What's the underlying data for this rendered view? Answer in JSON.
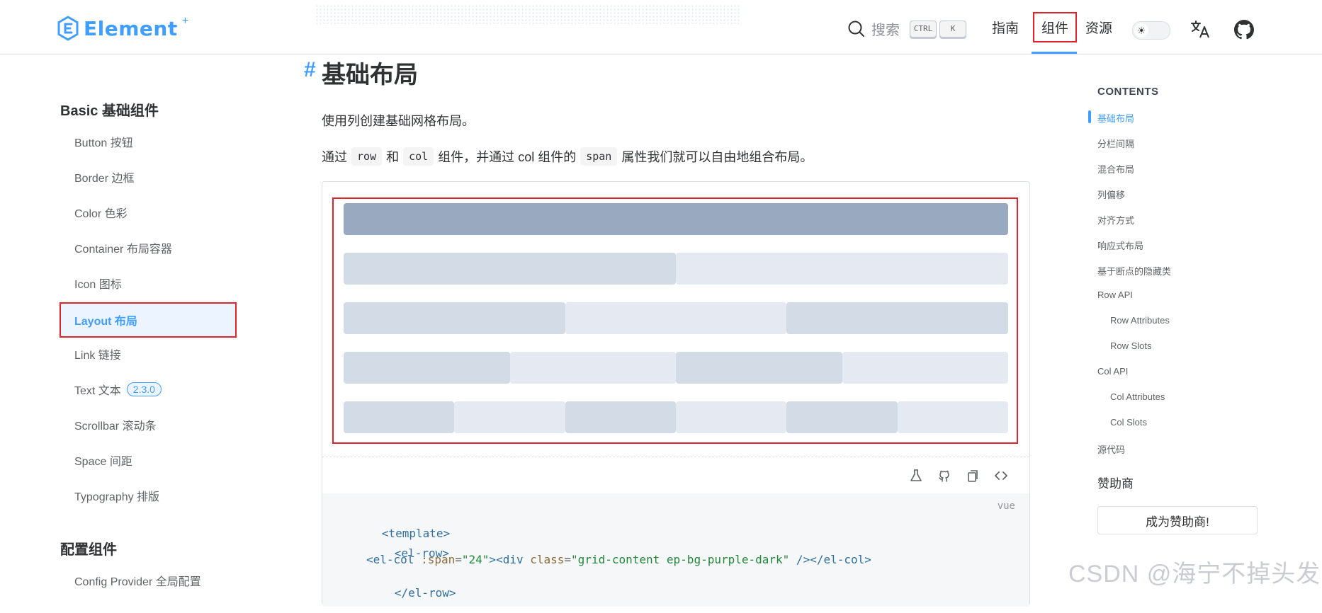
{
  "header": {
    "logo_text": "Element",
    "logo_sup": "+",
    "search_placeholder": "搜索",
    "kbd_ctrl": "CTRL",
    "kbd_k": "K",
    "nav": {
      "guide": "指南",
      "component": "组件",
      "resource": "资源"
    },
    "accent": "#409eff"
  },
  "sidebar": {
    "groups": [
      {
        "title": "Basic 基础组件",
        "items": [
          {
            "label": "Button 按钮"
          },
          {
            "label": "Border 边框"
          },
          {
            "label": "Color 色彩"
          },
          {
            "label": "Container 布局容器"
          },
          {
            "label": "Icon 图标"
          },
          {
            "label": "Layout 布局",
            "active": true
          },
          {
            "label": "Link 链接"
          },
          {
            "label": "Text 文本",
            "badge": "2.3.0"
          },
          {
            "label": "Scrollbar 滚动条"
          },
          {
            "label": "Space 间距"
          },
          {
            "label": "Typography 排版"
          }
        ]
      },
      {
        "title": "配置组件",
        "items": [
          {
            "label": "Config Provider 全局配置"
          }
        ]
      }
    ]
  },
  "main": {
    "anchor": "#",
    "title": "基础布局",
    "para1": "使用列创建基础网格布局。",
    "para2": {
      "t1": "通过",
      "c1": "row",
      "t2": "和",
      "c2": "col",
      "t3": "组件，并通过 col 组件的",
      "c3": "span",
      "t4": "属性我们就可以自由地组合布局。"
    },
    "demo_rows": [
      {
        "spans": [
          24
        ]
      },
      {
        "spans": [
          12,
          12
        ]
      },
      {
        "spans": [
          8,
          8,
          8
        ]
      },
      {
        "spans": [
          6,
          6,
          6,
          6
        ]
      },
      {
        "spans": [
          4,
          4,
          4,
          4,
          4,
          4
        ]
      }
    ],
    "toolbar_icons": [
      "playground-icon",
      "github-icon",
      "copy-icon",
      "code-toggle-icon"
    ],
    "code": {
      "lang": "vue",
      "lines": {
        "l1_tag": "<template>",
        "l2_tag": "<el-row>",
        "l3_open": "<el-col",
        "l3_attr": ":span",
        "l3_eq": "=",
        "l3_val": "\"24\"",
        "l3_gt": ">",
        "l3_div": "<div",
        "l3_class_attr": "class",
        "l3_class_val": "\"grid-content ep-bg-purple-dark\"",
        "l3_selfclose": " />",
        "l3_close": "</el-col>",
        "l4_tag": "</el-row>"
      }
    }
  },
  "toc": {
    "title": "CONTENTS",
    "items": [
      {
        "label": "基础布局",
        "active": true,
        "level": 1
      },
      {
        "label": "分栏间隔",
        "level": 1
      },
      {
        "label": "混合布局",
        "level": 1
      },
      {
        "label": "列偏移",
        "level": 1
      },
      {
        "label": "对齐方式",
        "level": 1
      },
      {
        "label": "响应式布局",
        "level": 1
      },
      {
        "label": "基于断点的隐藏类",
        "level": 1
      },
      {
        "label": "Row API",
        "level": 1
      },
      {
        "label": "Row Attributes",
        "level": 2
      },
      {
        "label": "Row Slots",
        "level": 2
      },
      {
        "label": "Col API",
        "level": 1
      },
      {
        "label": "Col Attributes",
        "level": 2
      },
      {
        "label": "Col Slots",
        "level": 2
      },
      {
        "label": "源代码",
        "level": 1
      }
    ],
    "sponsor_title": "赞助商",
    "sponsor_button": "成为赞助商!"
  },
  "watermark": "CSDN @海宁不掉头发"
}
